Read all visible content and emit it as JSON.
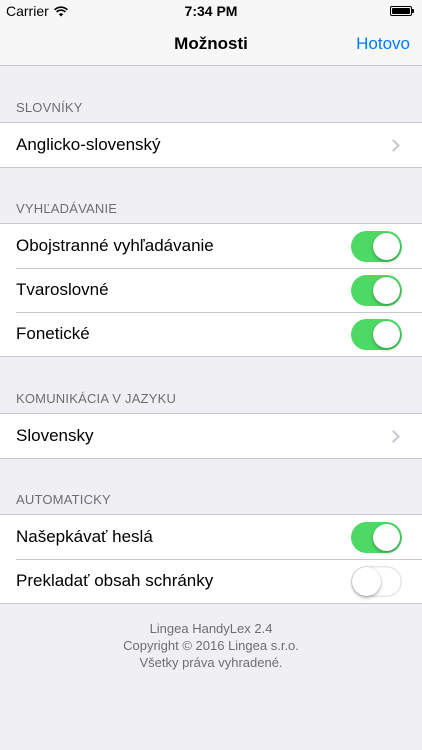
{
  "status_bar": {
    "carrier": "Carrier",
    "time": "7:34 PM"
  },
  "nav": {
    "title": "Možnosti",
    "done_label": "Hotovo"
  },
  "sections": {
    "dictionaries": {
      "header": "SLOVNÍKY",
      "rows": [
        {
          "label": "Anglicko-slovenský"
        }
      ]
    },
    "search": {
      "header": "VYHĽADÁVANIE",
      "rows": [
        {
          "label": "Obojstranné vyhľadávanie",
          "on": true
        },
        {
          "label": "Tvaroslovné",
          "on": true
        },
        {
          "label": "Fonetické",
          "on": true
        }
      ]
    },
    "language": {
      "header": "KOMUNIKÁCIA V JAZYKU",
      "rows": [
        {
          "label": "Slovensky"
        }
      ]
    },
    "automatic": {
      "header": "AUTOMATICKY",
      "rows": [
        {
          "label": "Našepkávať heslá",
          "on": true
        },
        {
          "label": "Prekladať obsah schránky",
          "on": false
        }
      ]
    }
  },
  "footer": {
    "line1": "Lingea HandyLex 2.4",
    "line2": "Copyright © 2016 Lingea s.r.o.",
    "line3": "Všetky práva vyhradené."
  },
  "colors": {
    "accent": "#007aff",
    "switch_on": "#4cd964",
    "background": "#efeff4"
  }
}
